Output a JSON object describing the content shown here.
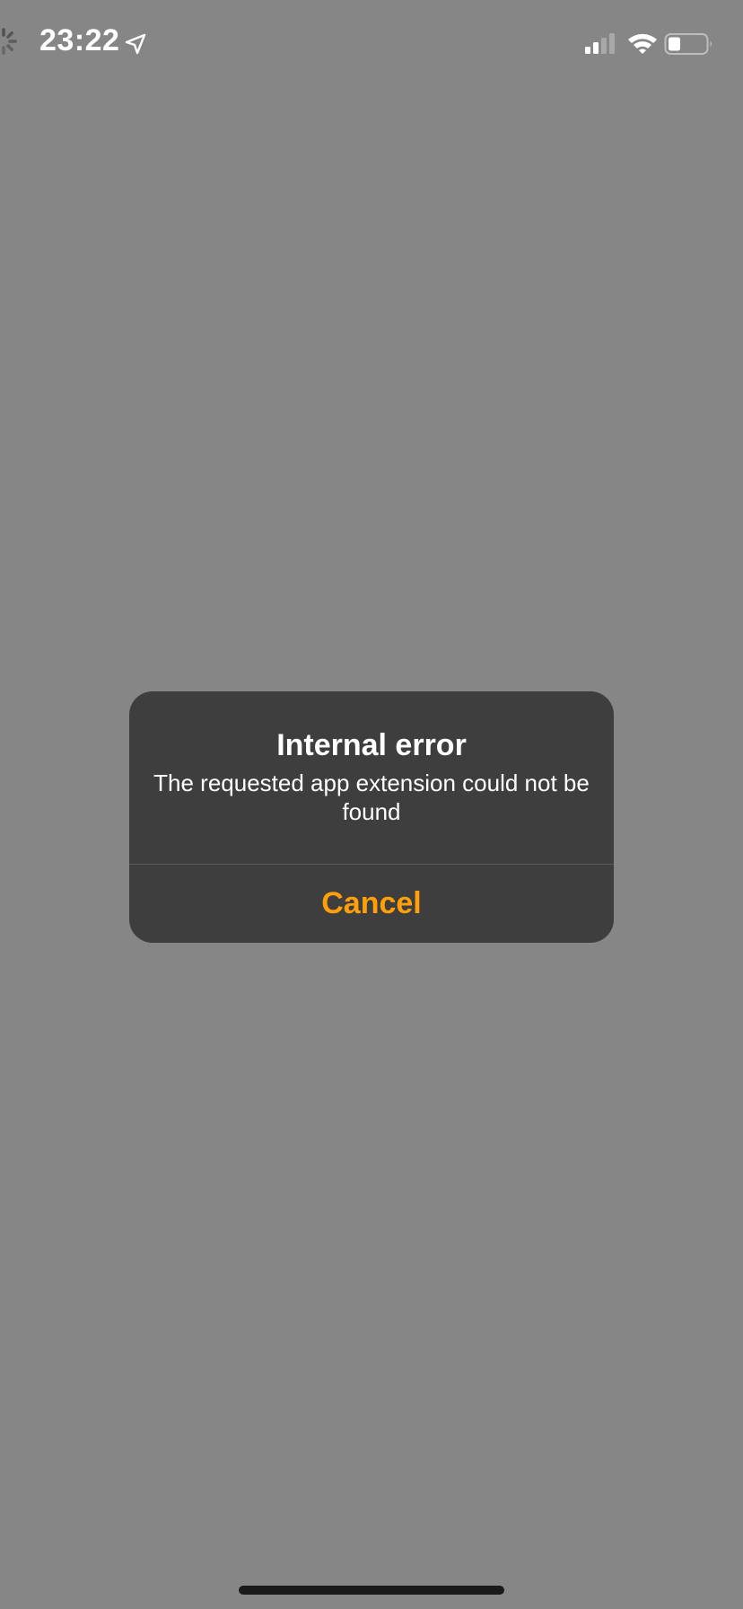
{
  "status_bar": {
    "time": "23:22",
    "icons": [
      "activity-spinner-icon",
      "location-arrow-icon",
      "cellular-signal-icon",
      "wifi-icon",
      "battery-icon"
    ]
  },
  "alert": {
    "title": "Internal error",
    "message": "The requested app extension could not be found",
    "cancel_label": "Cancel"
  },
  "colors": {
    "background": "#868686",
    "alert_background": "#3e3e3e",
    "accent": "#ff9f0a",
    "text": "#ffffff"
  }
}
